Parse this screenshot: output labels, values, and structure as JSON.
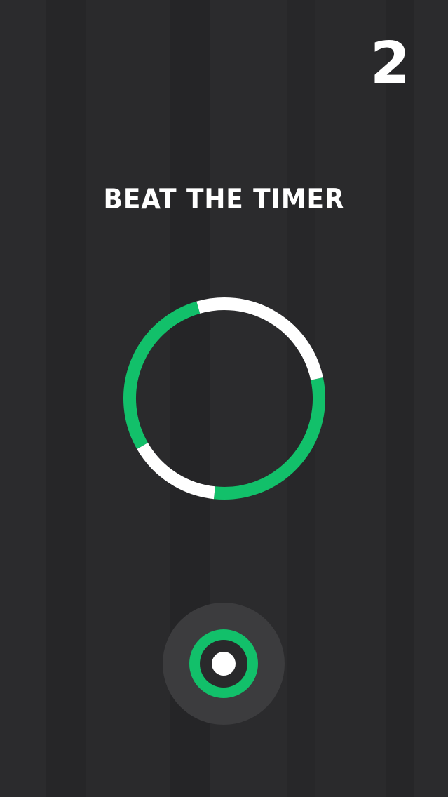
{
  "game": {
    "score": "2",
    "mode_title": "BEAT THE TIMER"
  },
  "colors": {
    "background": "#29292b",
    "accent_green": "#12c06a",
    "ring_white": "#ffffff",
    "button_bg": "#3c3c3e"
  },
  "timer_ring": {
    "segments": [
      {
        "color": "green",
        "from_deg": -12,
        "to_deg": 96
      },
      {
        "color": "white",
        "from_deg": 96,
        "to_deg": 150
      },
      {
        "color": "green",
        "from_deg": 150,
        "to_deg": 254
      },
      {
        "color": "white",
        "from_deg": 254,
        "to_deg": 348
      }
    ]
  },
  "tap_button": {
    "icon": "target-icon"
  }
}
